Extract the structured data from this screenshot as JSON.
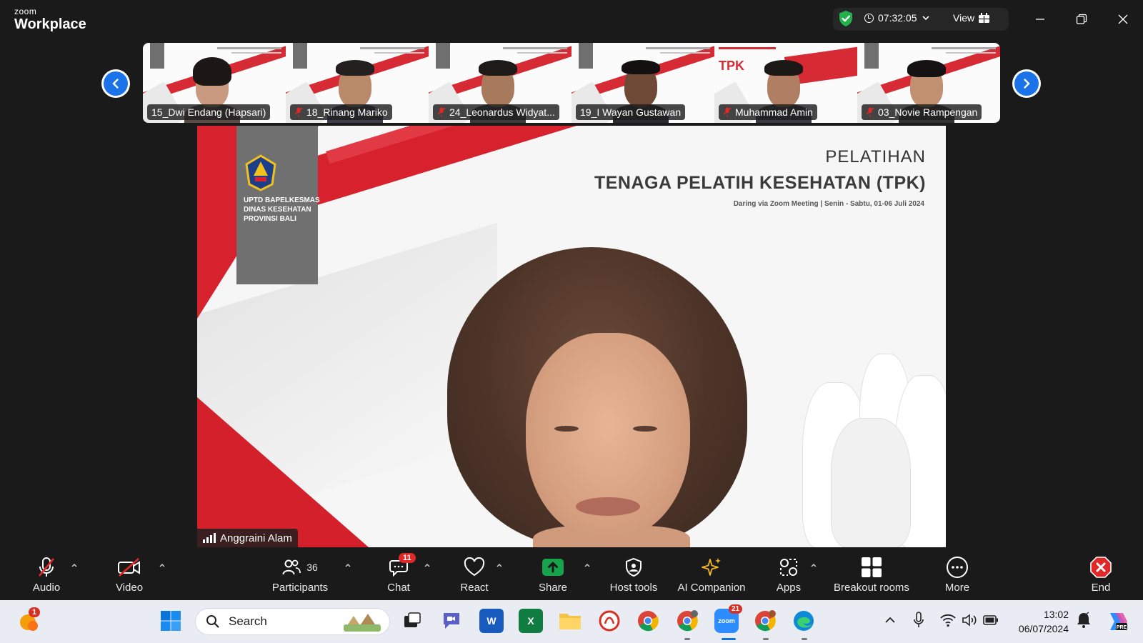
{
  "app": {
    "brand_top": "zoom",
    "brand_bottom": "Workplace",
    "timer": "07:32:05",
    "view_label": "View"
  },
  "participants_strip": [
    {
      "name": "15_Dwi Endang (Hapsari)",
      "muted": false
    },
    {
      "name": "18_Rinang Mariko",
      "muted": true
    },
    {
      "name": "24_Leonardus Widyat...",
      "muted": true
    },
    {
      "name": "19_I Wayan Gustawan",
      "muted": false
    },
    {
      "name": "Muhammad Amin",
      "muted": true
    },
    {
      "name": "03_Novie Rampengan",
      "muted": true
    }
  ],
  "slide": {
    "title_line1": "PELATIHAN",
    "title_line2": "TENAGA PELATIH KESEHATAN (TPK)",
    "subtitle": "Daring via Zoom Meeting | Senin - Sabtu, 01-06 Juli 2024",
    "org": "UPTD BAPELKESMAS\nDINAS KESEHATAN\nPROVINSI BALI"
  },
  "active_speaker": "Anggraini Alam",
  "toolbar": {
    "audio": "Audio",
    "video": "Video",
    "participants": "Participants",
    "participants_count": "36",
    "chat": "Chat",
    "chat_badge": "11",
    "react": "React",
    "share": "Share",
    "host_tools": "Host tools",
    "ai_companion": "AI Companion",
    "apps": "Apps",
    "breakout": "Breakout rooms",
    "more": "More",
    "end": "End"
  },
  "taskbar": {
    "search_placeholder": "Search",
    "weather_badge": "1",
    "zoom_badge": "21",
    "time": "13:02",
    "date": "06/07/2024"
  },
  "colors": {
    "accent_blue": "#1a73e8",
    "slide_red": "#d7212c",
    "end_red": "#e02828",
    "share_green": "#16a34a"
  }
}
